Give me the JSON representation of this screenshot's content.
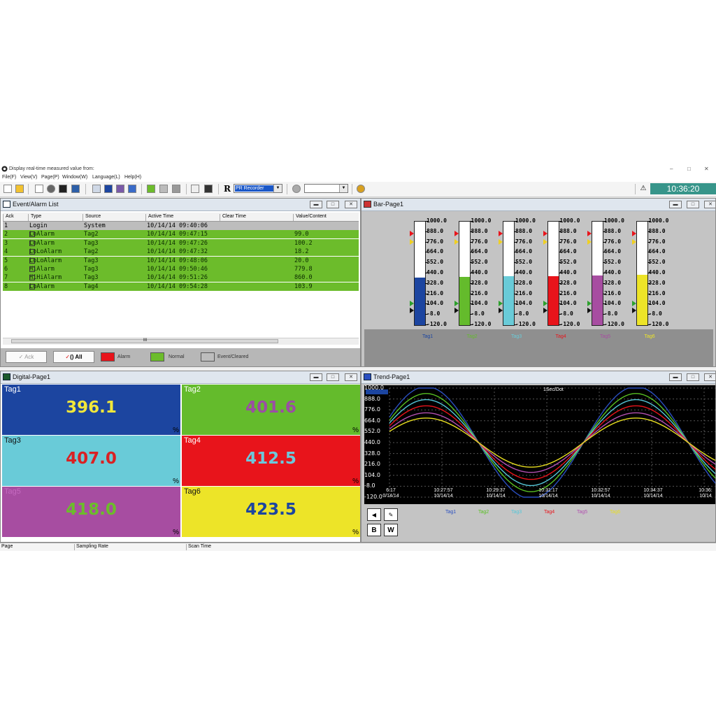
{
  "window": {
    "title": "Display real-time measured value from:"
  },
  "menu": [
    "File(F)",
    "View(V)",
    "Page(P)",
    "Window(W)",
    "Language(L)",
    "Help(H)"
  ],
  "toolbar": {
    "combo_value": "PR Recorder",
    "r_label": "R",
    "clock": "10:36:20"
  },
  "event_list": {
    "title": "Event/Alarm List",
    "columns": [
      "Ack",
      "Type",
      "Source",
      "Active Time",
      "Clear Time",
      "Value/Content"
    ],
    "rows": [
      {
        "ack": "1",
        "type": "Login",
        "source": "System",
        "active": "10/14/14 09:40:06",
        "clear": "",
        "value": "",
        "state": "event"
      },
      {
        "ack": "2",
        "type": "LoAlarm",
        "source": "Tag2",
        "active": "10/14/14 09:47:15",
        "clear": "",
        "value": "99.0",
        "state": "normal"
      },
      {
        "ack": "3",
        "type": "LoAlarm",
        "source": "Tag3",
        "active": "10/14/14 09:47:26",
        "clear": "",
        "value": "100.2",
        "state": "normal"
      },
      {
        "ack": "4",
        "type": "LoLoAlarm",
        "source": "Tag2",
        "active": "10/14/14 09:47:32",
        "clear": "",
        "value": "18.2",
        "state": "normal"
      },
      {
        "ack": "5",
        "type": "LoLoAlarm",
        "source": "Tag3",
        "active": "10/14/14 09:48:06",
        "clear": "",
        "value": "20.0",
        "state": "normal"
      },
      {
        "ack": "6",
        "type": "HiAlarm",
        "source": "Tag3",
        "active": "10/14/14 09:50:46",
        "clear": "",
        "value": "779.8",
        "state": "normal"
      },
      {
        "ack": "7",
        "type": "HiHiAlarm",
        "source": "Tag3",
        "active": "10/14/14 09:51:26",
        "clear": "",
        "value": "860.0",
        "state": "normal"
      },
      {
        "ack": "8",
        "type": "LoAlarm",
        "source": "Tag4",
        "active": "10/14/14 09:54:28",
        "clear": "",
        "value": "103.9",
        "state": "normal"
      }
    ],
    "scroll_glyph": "III",
    "ack_label": "Ack",
    "all_label": "All",
    "legend": {
      "alarm": "Alarm",
      "normal": "Normal",
      "event": "Event/Cleared"
    },
    "colors": {
      "normal": "#6cbc2b",
      "alarm": "#e8141b",
      "event": "#bdbdbd"
    }
  },
  "bar_page": {
    "title": "Bar-Page1",
    "scale": [
      "1000.0",
      "888.0",
      "776.0",
      "664.0",
      "552.0",
      "440.0",
      "328.0",
      "216.0",
      "104.0",
      "-8.0",
      "-120.0"
    ],
    "min": -120,
    "max": 1000,
    "tags": [
      {
        "name": "Tag1",
        "value": 396.1,
        "color": "#1c45a0"
      },
      {
        "name": "Tag2",
        "value": 401.6,
        "color": "#64bb2c"
      },
      {
        "name": "Tag3",
        "value": 407.0,
        "color": "#69cbd8"
      },
      {
        "name": "Tag4",
        "value": 412.5,
        "color": "#e8141b"
      },
      {
        "name": "Tag5",
        "value": 418.0,
        "color": "#a74da1"
      },
      {
        "name": "Tag6",
        "value": 423.5,
        "color": "#ede428"
      }
    ]
  },
  "digital_page": {
    "title": "Digital-Page1",
    "tiles": [
      {
        "name": "Tag1",
        "value": "396.1",
        "unit": "%",
        "bg": "#1c45a0",
        "fg": "#f1e73a",
        "name_color": "#ffffff"
      },
      {
        "name": "Tag2",
        "value": "401.6",
        "unit": "%",
        "bg": "#64bb2c",
        "fg": "#9b4da5",
        "name_color": "#ffffff"
      },
      {
        "name": "Tag3",
        "value": "407.0",
        "unit": "%",
        "bg": "#69cbd8",
        "fg": "#d92123",
        "name_color": "#111111"
      },
      {
        "name": "Tag4",
        "value": "412.5",
        "unit": "%",
        "bg": "#e8141b",
        "fg": "#6cc8dc",
        "name_color": "#ffffff"
      },
      {
        "name": "Tag5",
        "value": "418.0",
        "unit": "%",
        "bg": "#a74da1",
        "fg": "#6cbc2b",
        "name_color": "#c56ac0"
      },
      {
        "name": "Tag6",
        "value": "423.5",
        "unit": "%",
        "bg": "#ede428",
        "fg": "#1c45a0",
        "name_color": "#111111"
      }
    ]
  },
  "trend_page": {
    "title": "Trend-Page1",
    "rate_label": "1Sec/Dot",
    "y_ticks": [
      "1000.0",
      "888.0",
      "776.0",
      "664.0",
      "552.0",
      "440.0",
      "328.0",
      "216.0",
      "104.0",
      "-8.0",
      "-120.0"
    ],
    "x_ticks": [
      {
        "time": "6:17",
        "date": "0/14/14"
      },
      {
        "time": "10:27:57",
        "date": "10/14/14"
      },
      {
        "time": "10:29:37",
        "date": "10/14/14"
      },
      {
        "time": "10:31:17",
        "date": "10/14/14"
      },
      {
        "time": "10:32:57",
        "date": "10/14/14"
      },
      {
        "time": "10:34:37",
        "date": "10/14/14"
      },
      {
        "time": "10:36:",
        "date": "10/14"
      }
    ],
    "legend": [
      {
        "name": "Tag1",
        "color": "#2a4fc0"
      },
      {
        "name": "Tag2",
        "color": "#58c023"
      },
      {
        "name": "Tag3",
        "color": "#55c7d9"
      },
      {
        "name": "Tag4",
        "color": "#e8141b"
      },
      {
        "name": "Tag5",
        "color": "#b24fb0"
      },
      {
        "name": "Tag6",
        "color": "#e8de20"
      }
    ],
    "btn_b": "B",
    "btn_w": "W"
  },
  "status_bar": [
    "Page",
    "Sampling Rate",
    "Scan Time"
  ]
}
